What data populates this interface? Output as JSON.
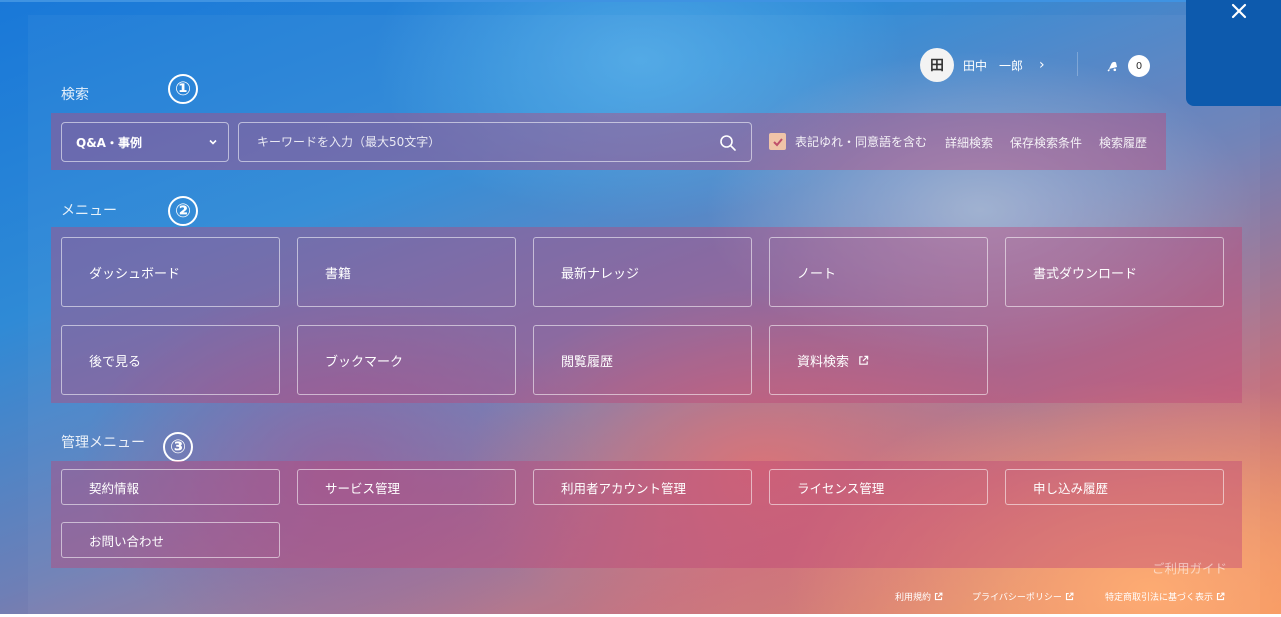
{
  "header": {
    "user": {
      "avatar_text": "田",
      "name": "田中　一郎",
      "chevron": "›"
    },
    "notifications": {
      "icon": "bell-icon",
      "count": "0"
    },
    "close": {
      "icon": "close-icon"
    }
  },
  "markers": [
    "①",
    "②",
    "③"
  ],
  "search": {
    "label": "検索",
    "category": "Q&A・事例",
    "placeholder": "キーワードを入力（最大50文字）",
    "option_label": "表記ゆれ・同意語を含む",
    "option_checked": true,
    "links": [
      "詳細検索",
      "保存検索条件",
      "検索履歴"
    ]
  },
  "menu": {
    "label": "メニュー",
    "items": [
      "ダッシュボード",
      "書籍",
      "最新ナレッジ",
      "ノート",
      "書式ダウンロード",
      "後で見る",
      "ブックマーク",
      "閲覧履歴",
      "資料検索"
    ]
  },
  "admin": {
    "label": "管理メニュー",
    "items": [
      "契約情報",
      "サービス管理",
      "利用者アカウント管理",
      "ライセンス管理",
      "申し込み履歴",
      "お問い合わせ"
    ]
  },
  "footer": {
    "guide": "ご利用ガイド",
    "links": [
      "利用規約",
      "プライバシーポリシー",
      "特定商取引法に基づく表示"
    ]
  },
  "colors": {
    "highlight": "#be4678",
    "close_panel": "#0d5aad",
    "checkbox": "#f0c4a8"
  }
}
